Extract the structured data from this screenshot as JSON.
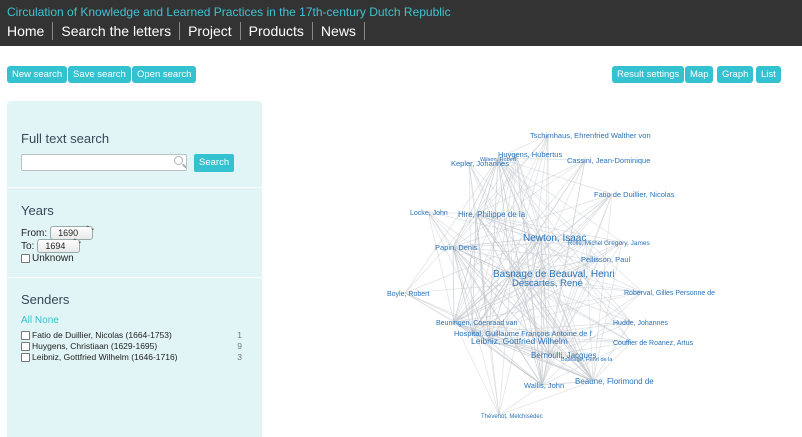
{
  "site_title": "Circulation of Knowledge and Learned Practices in the 17th-century Dutch Republic",
  "nav": [
    "Home",
    "Search the letters",
    "Project",
    "Products",
    "News"
  ],
  "actions": {
    "new_search": "New search",
    "save_search": "Save search",
    "open_search": "Open search",
    "result_settings": "Result settings",
    "map": "Map",
    "graph": "Graph",
    "list": "List"
  },
  "fulltext": {
    "title": "Full text search",
    "button": "Search",
    "value": ""
  },
  "years": {
    "title": "Years",
    "from_label": "From:",
    "from_value": "1690",
    "to_label": "To:",
    "to_value": "1694",
    "unknown_label": "Unknown"
  },
  "senders": {
    "title": "Senders",
    "all": "All",
    "none": "None",
    "items": [
      {
        "name": "Fatio de Duillier, Nicolas (1664-1753)",
        "count": "1"
      },
      {
        "name": "Huygens, Christiaan (1629-1695)",
        "count": "9"
      },
      {
        "name": "Leibniz, Gottfried Wilhelm (1646-1716)",
        "count": "3"
      }
    ]
  },
  "graph_nodes": [
    "Tschirnhaus, Ehrenfried Walther von",
    "Huygens, Hubertus",
    "Wilson, Robert",
    "Kepler, Johannes",
    "Cassini, Jean-Dominique",
    "Fatio de Duillier, Nicolas",
    "Locke, John",
    "Hire, Philippe de la",
    "Newton, Isaac",
    "Papin, Denis",
    "Rolle, Michel",
    "Gregory, James",
    "Pellisson, Paul",
    "Basnage de Beauval, Henri",
    "Descartes, René",
    "Boyle, Robert",
    "Roberval, Gilles Personne de",
    "Beuningen, Coenraad van",
    "Hospital, Guillaume François Antoine de l'",
    "Hudde, Johannes",
    "Leibniz, Gottfried Wilhelm",
    "Couffier de Roanez, Artus",
    "Bernoulli, Jacques",
    "Basnage, Henri de la",
    "Beaune, Florimond de",
    "Wallis, John",
    "Thévenot, Melchisédec"
  ]
}
